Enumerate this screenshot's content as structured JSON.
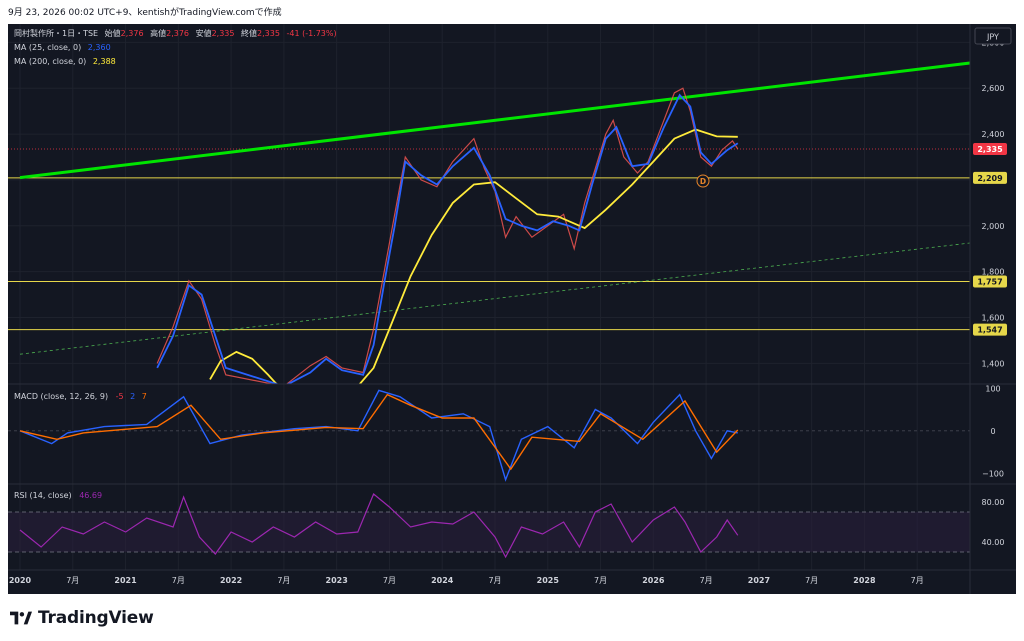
{
  "header": {
    "caption": "9月 23, 2026 00:02 UTC+9、kentishがTradingView.comで作成"
  },
  "footer": {
    "brand": "TradingView"
  },
  "currency": "JPY",
  "colors": {
    "background": "#131722",
    "grid": "#1e222d",
    "green_line": "#00e500",
    "ma25": "#2962ff",
    "ma200": "#ffeb3b",
    "hline": "#e6d74a",
    "price_tag": "#f23645",
    "macd_line": "#2962ff",
    "signal_line": "#ff6d00",
    "rsi": "#9c27b0",
    "rsi_band": "#2a1f3d",
    "candle_up": "#26a69a",
    "candle_down": "#ef5350"
  },
  "legend": {
    "symbol": "岡村製作所・1日・TSE",
    "open_label": "始値",
    "open_val": "2,376",
    "high_label": "高値",
    "high_val": "2,376",
    "low_label": "安値",
    "low_val": "2,335",
    "close_label": "終値",
    "close_val": "2,335",
    "change": "-41 (-1.73%)",
    "ma25_label": "MA (25, close, 0)",
    "ma25_val": "2,360",
    "ma200_label": "MA (200, close, 0)",
    "ma200_val": "2,388"
  },
  "macd_legend": {
    "label": "MACD (close, 12, 26, 9)",
    "v1": "-5",
    "v2": "2",
    "v3": "7"
  },
  "rsi_legend": {
    "label": "RSI (14, close)",
    "value": "46.69"
  },
  "event_marker": "D",
  "chart_data": {
    "type": "line",
    "price_axis": {
      "ticks": [
        "1,400",
        "1,600",
        "1,800",
        "2,000",
        "2,200",
        "2,400",
        "2,600",
        "2,800"
      ],
      "range": [
        1310,
        2880
      ]
    },
    "price_labels": [
      {
        "value": 2335,
        "text": "2,335",
        "kind": "last"
      },
      {
        "value": 2209,
        "text": "2,209",
        "kind": "line"
      },
      {
        "value": 1757,
        "text": "1,757",
        "kind": "line"
      },
      {
        "value": 1547,
        "text": "1,547",
        "kind": "line"
      }
    ],
    "horizontal_lines": [
      2209,
      1757,
      1547
    ],
    "last_price_dotted": 2335,
    "trendline_green": [
      {
        "t": 2020.0,
        "p": 2210
      },
      {
        "t": 2029.0,
        "p": 2710
      }
    ],
    "trendline_dashed": [
      {
        "t": 2020.0,
        "p": 1440
      },
      {
        "t": 2029.0,
        "p": 1925
      }
    ],
    "time_axis": {
      "ticks": [
        {
          "t": 2020.0,
          "label": "2020",
          "major": true
        },
        {
          "t": 2020.5,
          "label": "7月",
          "major": false
        },
        {
          "t": 2021.0,
          "label": "2021",
          "major": true
        },
        {
          "t": 2021.5,
          "label": "7月",
          "major": false
        },
        {
          "t": 2022.0,
          "label": "2022",
          "major": true
        },
        {
          "t": 2022.5,
          "label": "7月",
          "major": false
        },
        {
          "t": 2023.0,
          "label": "2023",
          "major": true
        },
        {
          "t": 2023.5,
          "label": "7月",
          "major": false
        },
        {
          "t": 2024.0,
          "label": "2024",
          "major": true
        },
        {
          "t": 2024.5,
          "label": "7月",
          "major": false
        },
        {
          "t": 2025.0,
          "label": "2025",
          "major": true
        },
        {
          "t": 2025.5,
          "label": "7月",
          "major": false
        },
        {
          "t": 2026.0,
          "label": "2026",
          "major": true
        },
        {
          "t": 2026.5,
          "label": "7月",
          "major": false
        },
        {
          "t": 2027.0,
          "label": "2027",
          "major": true
        },
        {
          "t": 2027.5,
          "label": "7月",
          "major": false
        },
        {
          "t": 2028.0,
          "label": "2028",
          "major": true
        },
        {
          "t": 2028.5,
          "label": "7月",
          "major": false
        }
      ]
    },
    "price_series": [
      {
        "t": 2021.3,
        "p": 1400
      },
      {
        "t": 2021.45,
        "p": 1560
      },
      {
        "t": 2021.6,
        "p": 1760
      },
      {
        "t": 2021.72,
        "p": 1680
      },
      {
        "t": 2021.85,
        "p": 1480
      },
      {
        "t": 2021.95,
        "p": 1350
      },
      {
        "t": 2022.5,
        "p": 1300
      },
      {
        "t": 2022.75,
        "p": 1390
      },
      {
        "t": 2022.9,
        "p": 1430
      },
      {
        "t": 2023.05,
        "p": 1380
      },
      {
        "t": 2023.25,
        "p": 1360
      },
      {
        "t": 2023.35,
        "p": 1550
      },
      {
        "t": 2023.45,
        "p": 1800
      },
      {
        "t": 2023.55,
        "p": 2050
      },
      {
        "t": 2023.65,
        "p": 2300
      },
      {
        "t": 2023.8,
        "p": 2200
      },
      {
        "t": 2023.95,
        "p": 2170
      },
      {
        "t": 2024.1,
        "p": 2280
      },
      {
        "t": 2024.3,
        "p": 2380
      },
      {
        "t": 2024.4,
        "p": 2250
      },
      {
        "t": 2024.5,
        "p": 2150
      },
      {
        "t": 2024.6,
        "p": 1950
      },
      {
        "t": 2024.7,
        "p": 2040
      },
      {
        "t": 2024.85,
        "p": 1950
      },
      {
        "t": 2025.0,
        "p": 2000
      },
      {
        "t": 2025.15,
        "p": 2050
      },
      {
        "t": 2025.25,
        "p": 1900
      },
      {
        "t": 2025.35,
        "p": 2100
      },
      {
        "t": 2025.45,
        "p": 2250
      },
      {
        "t": 2025.55,
        "p": 2400
      },
      {
        "t": 2025.62,
        "p": 2460
      },
      {
        "t": 2025.72,
        "p": 2300
      },
      {
        "t": 2025.85,
        "p": 2230
      },
      {
        "t": 2025.95,
        "p": 2280
      },
      {
        "t": 2026.1,
        "p": 2460
      },
      {
        "t": 2026.2,
        "p": 2580
      },
      {
        "t": 2026.28,
        "p": 2600
      },
      {
        "t": 2026.35,
        "p": 2500
      },
      {
        "t": 2026.45,
        "p": 2300
      },
      {
        "t": 2026.55,
        "p": 2260
      },
      {
        "t": 2026.65,
        "p": 2330
      },
      {
        "t": 2026.75,
        "p": 2370
      },
      {
        "t": 2026.8,
        "p": 2335
      }
    ],
    "ma25_series": [
      {
        "t": 2021.3,
        "p": 1380
      },
      {
        "t": 2021.45,
        "p": 1520
      },
      {
        "t": 2021.6,
        "p": 1740
      },
      {
        "t": 2021.72,
        "p": 1700
      },
      {
        "t": 2021.85,
        "p": 1520
      },
      {
        "t": 2021.95,
        "p": 1380
      },
      {
        "t": 2022.5,
        "p": 1300
      },
      {
        "t": 2022.75,
        "p": 1360
      },
      {
        "t": 2022.9,
        "p": 1420
      },
      {
        "t": 2023.05,
        "p": 1370
      },
      {
        "t": 2023.25,
        "p": 1350
      },
      {
        "t": 2023.35,
        "p": 1480
      },
      {
        "t": 2023.45,
        "p": 1750
      },
      {
        "t": 2023.55,
        "p": 2000
      },
      {
        "t": 2023.65,
        "p": 2280
      },
      {
        "t": 2023.8,
        "p": 2220
      },
      {
        "t": 2023.95,
        "p": 2180
      },
      {
        "t": 2024.1,
        "p": 2260
      },
      {
        "t": 2024.3,
        "p": 2340
      },
      {
        "t": 2024.45,
        "p": 2220
      },
      {
        "t": 2024.6,
        "p": 2030
      },
      {
        "t": 2024.75,
        "p": 2000
      },
      {
        "t": 2024.9,
        "p": 1980
      },
      {
        "t": 2025.05,
        "p": 2020
      },
      {
        "t": 2025.2,
        "p": 2000
      },
      {
        "t": 2025.3,
        "p": 1980
      },
      {
        "t": 2025.42,
        "p": 2180
      },
      {
        "t": 2025.55,
        "p": 2380
      },
      {
        "t": 2025.65,
        "p": 2430
      },
      {
        "t": 2025.8,
        "p": 2260
      },
      {
        "t": 2025.95,
        "p": 2270
      },
      {
        "t": 2026.1,
        "p": 2430
      },
      {
        "t": 2026.25,
        "p": 2570
      },
      {
        "t": 2026.35,
        "p": 2520
      },
      {
        "t": 2026.45,
        "p": 2320
      },
      {
        "t": 2026.55,
        "p": 2270
      },
      {
        "t": 2026.7,
        "p": 2330
      },
      {
        "t": 2026.8,
        "p": 2360
      }
    ],
    "ma200_series": [
      {
        "t": 2021.8,
        "p": 1330
      },
      {
        "t": 2021.9,
        "p": 1410
      },
      {
        "t": 2022.05,
        "p": 1450
      },
      {
        "t": 2022.2,
        "p": 1420
      },
      {
        "t": 2022.35,
        "p": 1350
      },
      {
        "t": 2022.45,
        "p": 1300
      },
      {
        "t": 2023.2,
        "p": 1300
      },
      {
        "t": 2023.35,
        "p": 1380
      },
      {
        "t": 2023.5,
        "p": 1550
      },
      {
        "t": 2023.7,
        "p": 1780
      },
      {
        "t": 2023.9,
        "p": 1960
      },
      {
        "t": 2024.1,
        "p": 2100
      },
      {
        "t": 2024.3,
        "p": 2180
      },
      {
        "t": 2024.5,
        "p": 2190
      },
      {
        "t": 2024.7,
        "p": 2120
      },
      {
        "t": 2024.9,
        "p": 2050
      },
      {
        "t": 2025.1,
        "p": 2040
      },
      {
        "t": 2025.35,
        "p": 1990
      },
      {
        "t": 2025.55,
        "p": 2070
      },
      {
        "t": 2025.8,
        "p": 2180
      },
      {
        "t": 2026.0,
        "p": 2280
      },
      {
        "t": 2026.2,
        "p": 2380
      },
      {
        "t": 2026.4,
        "p": 2420
      },
      {
        "t": 2026.6,
        "p": 2390
      },
      {
        "t": 2026.8,
        "p": 2388
      }
    ],
    "macd_axis": {
      "ticks": [
        "100",
        "0",
        "−100"
      ],
      "range": [
        -125,
        110
      ]
    },
    "macd_series": [
      {
        "t": 2020.0,
        "v": 0
      },
      {
        "t": 2020.3,
        "v": -30
      },
      {
        "t": 2020.45,
        "v": -5
      },
      {
        "t": 2020.8,
        "v": 10
      },
      {
        "t": 2021.2,
        "v": 15
      },
      {
        "t": 2021.55,
        "v": 80
      },
      {
        "t": 2021.8,
        "v": -30
      },
      {
        "t": 2022.1,
        "v": -10
      },
      {
        "t": 2022.6,
        "v": 5
      },
      {
        "t": 2022.9,
        "v": 10
      },
      {
        "t": 2023.2,
        "v": 0
      },
      {
        "t": 2023.4,
        "v": 95
      },
      {
        "t": 2023.6,
        "v": 80
      },
      {
        "t": 2023.9,
        "v": 30
      },
      {
        "t": 2024.2,
        "v": 40
      },
      {
        "t": 2024.45,
        "v": 10
      },
      {
        "t": 2024.6,
        "v": -115
      },
      {
        "t": 2024.75,
        "v": -20
      },
      {
        "t": 2025.0,
        "v": 10
      },
      {
        "t": 2025.25,
        "v": -40
      },
      {
        "t": 2025.45,
        "v": 50
      },
      {
        "t": 2025.6,
        "v": 30
      },
      {
        "t": 2025.85,
        "v": -30
      },
      {
        "t": 2026.0,
        "v": 20
      },
      {
        "t": 2026.25,
        "v": 85
      },
      {
        "t": 2026.4,
        "v": 0
      },
      {
        "t": 2026.55,
        "v": -65
      },
      {
        "t": 2026.7,
        "v": 0
      },
      {
        "t": 2026.8,
        "v": -5
      }
    ],
    "signal_series": [
      {
        "t": 2020.0,
        "v": 0
      },
      {
        "t": 2020.35,
        "v": -20
      },
      {
        "t": 2020.6,
        "v": -5
      },
      {
        "t": 2021.3,
        "v": 10
      },
      {
        "t": 2021.62,
        "v": 60
      },
      {
        "t": 2021.9,
        "v": -20
      },
      {
        "t": 2022.3,
        "v": -5
      },
      {
        "t": 2022.9,
        "v": 8
      },
      {
        "t": 2023.25,
        "v": 5
      },
      {
        "t": 2023.48,
        "v": 85
      },
      {
        "t": 2023.7,
        "v": 60
      },
      {
        "t": 2024.0,
        "v": 30
      },
      {
        "t": 2024.3,
        "v": 30
      },
      {
        "t": 2024.65,
        "v": -90
      },
      {
        "t": 2024.85,
        "v": -15
      },
      {
        "t": 2025.3,
        "v": -25
      },
      {
        "t": 2025.5,
        "v": 40
      },
      {
        "t": 2025.9,
        "v": -20
      },
      {
        "t": 2026.3,
        "v": 70
      },
      {
        "t": 2026.6,
        "v": -50
      },
      {
        "t": 2026.8,
        "v": 2
      }
    ],
    "rsi_axis": {
      "ticks": [
        "80.00",
        "40.00"
      ],
      "range": [
        12,
        98
      ],
      "band": [
        30,
        70
      ]
    },
    "rsi_series": [
      {
        "t": 2020.0,
        "v": 52
      },
      {
        "t": 2020.2,
        "v": 35
      },
      {
        "t": 2020.4,
        "v": 55
      },
      {
        "t": 2020.6,
        "v": 48
      },
      {
        "t": 2020.8,
        "v": 60
      },
      {
        "t": 2021.0,
        "v": 50
      },
      {
        "t": 2021.2,
        "v": 64
      },
      {
        "t": 2021.45,
        "v": 55
      },
      {
        "t": 2021.55,
        "v": 85
      },
      {
        "t": 2021.7,
        "v": 45
      },
      {
        "t": 2021.85,
        "v": 28
      },
      {
        "t": 2022.0,
        "v": 50
      },
      {
        "t": 2022.2,
        "v": 40
      },
      {
        "t": 2022.4,
        "v": 55
      },
      {
        "t": 2022.6,
        "v": 45
      },
      {
        "t": 2022.8,
        "v": 60
      },
      {
        "t": 2023.0,
        "v": 48
      },
      {
        "t": 2023.2,
        "v": 50
      },
      {
        "t": 2023.35,
        "v": 88
      },
      {
        "t": 2023.5,
        "v": 75
      },
      {
        "t": 2023.7,
        "v": 55
      },
      {
        "t": 2023.9,
        "v": 60
      },
      {
        "t": 2024.1,
        "v": 58
      },
      {
        "t": 2024.3,
        "v": 70
      },
      {
        "t": 2024.5,
        "v": 45
      },
      {
        "t": 2024.6,
        "v": 25
      },
      {
        "t": 2024.75,
        "v": 55
      },
      {
        "t": 2024.95,
        "v": 48
      },
      {
        "t": 2025.15,
        "v": 60
      },
      {
        "t": 2025.3,
        "v": 35
      },
      {
        "t": 2025.45,
        "v": 70
      },
      {
        "t": 2025.6,
        "v": 78
      },
      {
        "t": 2025.8,
        "v": 40
      },
      {
        "t": 2026.0,
        "v": 62
      },
      {
        "t": 2026.2,
        "v": 75
      },
      {
        "t": 2026.3,
        "v": 60
      },
      {
        "t": 2026.45,
        "v": 30
      },
      {
        "t": 2026.6,
        "v": 45
      },
      {
        "t": 2026.7,
        "v": 62
      },
      {
        "t": 2026.8,
        "v": 46.69
      }
    ]
  }
}
